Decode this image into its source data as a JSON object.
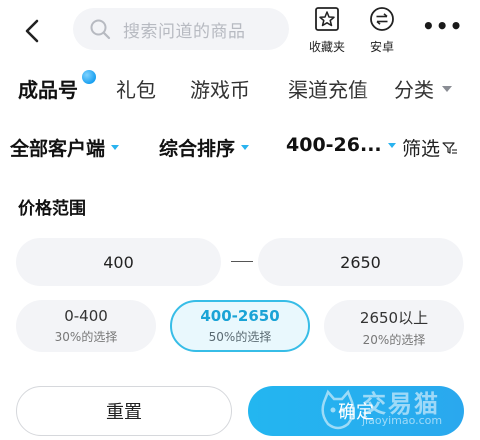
{
  "header": {
    "search_placeholder": "搜索问道的商品",
    "favorites_label": "收藏夹",
    "platform_label": "安卓"
  },
  "tabs": [
    {
      "label": "成品号",
      "active": true
    },
    {
      "label": "礼包"
    },
    {
      "label": "游戏币"
    },
    {
      "label": "渠道充值"
    },
    {
      "label": "分类"
    }
  ],
  "filters": {
    "client": "全部客户端",
    "sort": "综合排序",
    "price": "400-26...",
    "filter": "筛选"
  },
  "price": {
    "title": "价格范围",
    "min": "400",
    "max": "2650",
    "options": [
      {
        "range": "0-400",
        "share": "30%的选择",
        "selected": false
      },
      {
        "range": "400-2650",
        "share": "50%的选择",
        "selected": true
      },
      {
        "range": "2650以上",
        "share": "20%的选择",
        "selected": false
      }
    ]
  },
  "actions": {
    "reset": "重置",
    "confirm": "确定"
  },
  "watermark": {
    "name": "交易猫",
    "url": "jiaoyimao.com"
  },
  "colors": {
    "accent": "#2ab3ef",
    "selected_bg": "#e9f8fd",
    "input_bg": "#f3f4f7"
  }
}
